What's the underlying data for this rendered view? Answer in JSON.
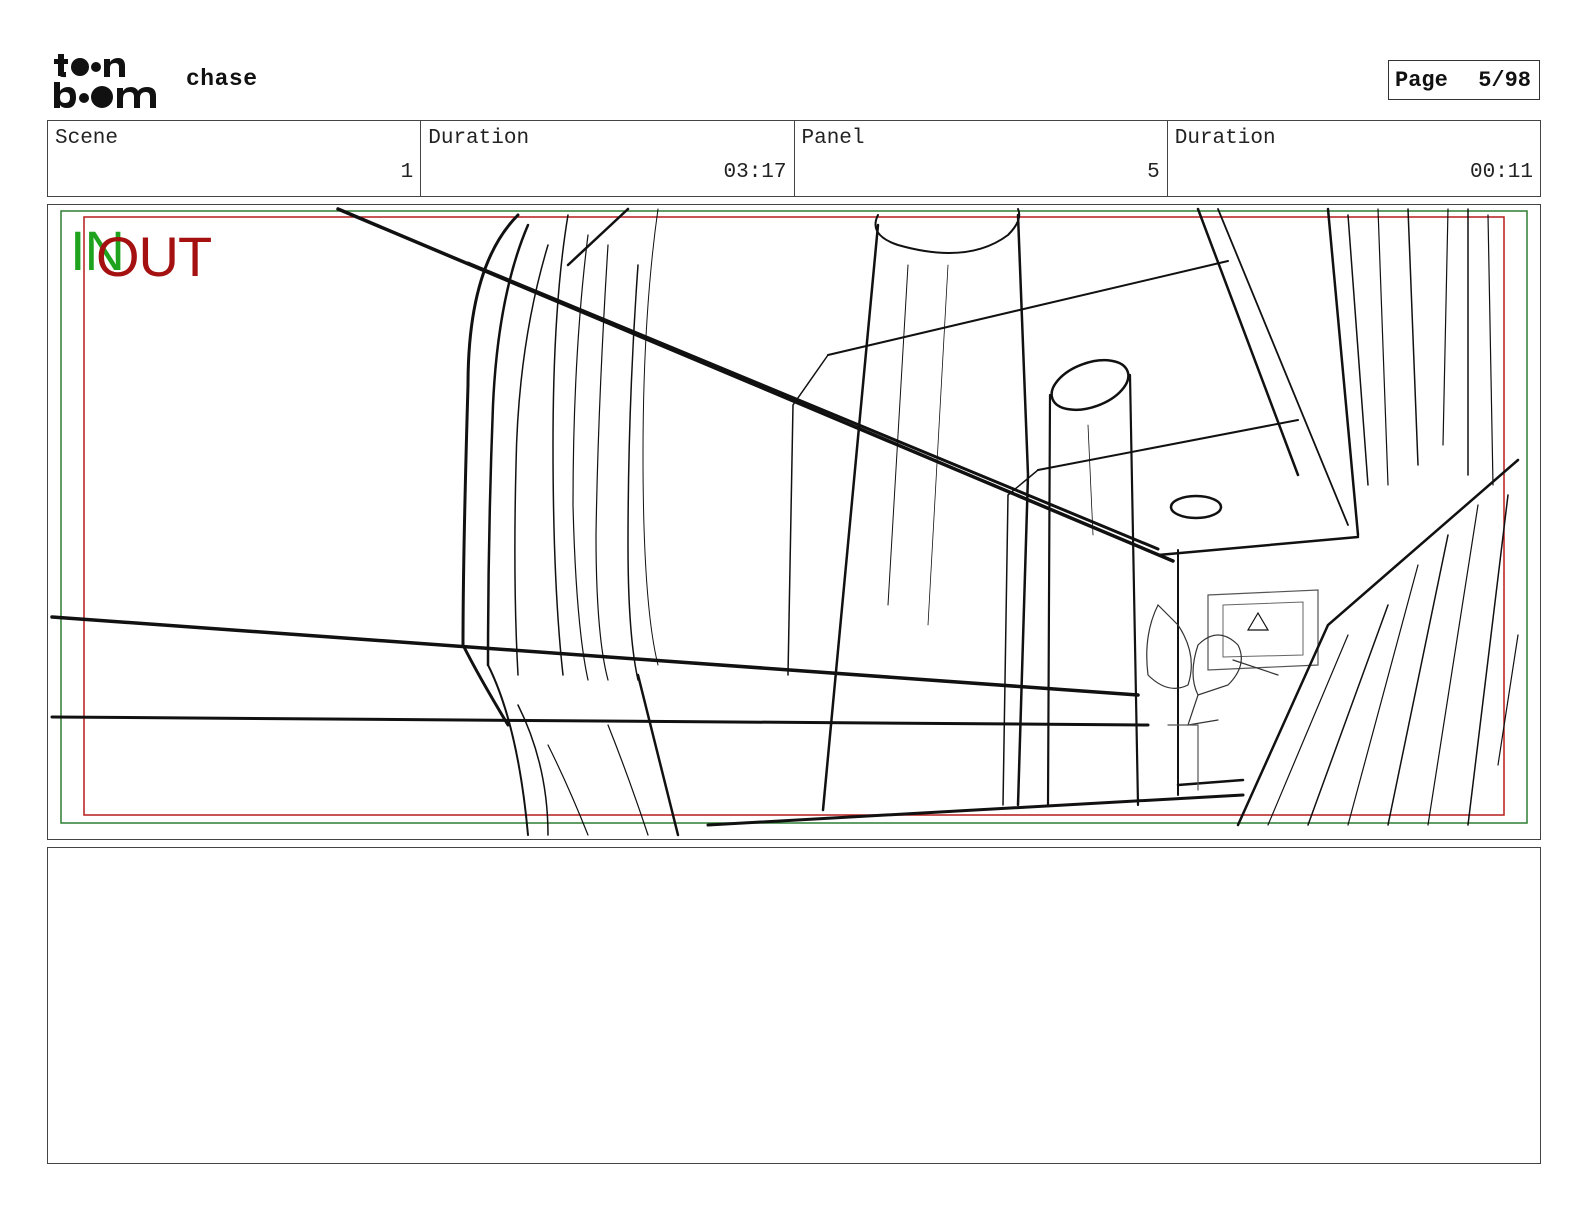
{
  "header": {
    "logo_text": "toon boom",
    "project_title": "chase",
    "page_label": "Page",
    "page_number": "5/98"
  },
  "info": {
    "scene_label": "Scene",
    "scene_value": "1",
    "scene_duration_label": "Duration",
    "scene_duration_value": "03:17",
    "panel_label": "Panel",
    "panel_value": "5",
    "panel_duration_label": "Duration",
    "panel_duration_value": "00:11"
  },
  "panel": {
    "in_label": "IN",
    "out_label": "OUT",
    "in_color": "#1fa31f",
    "out_color": "#a51010",
    "safe_frame_green": "#2e7d32",
    "safe_frame_red": "#b71c1c"
  },
  "notes": {
    "text": ""
  }
}
